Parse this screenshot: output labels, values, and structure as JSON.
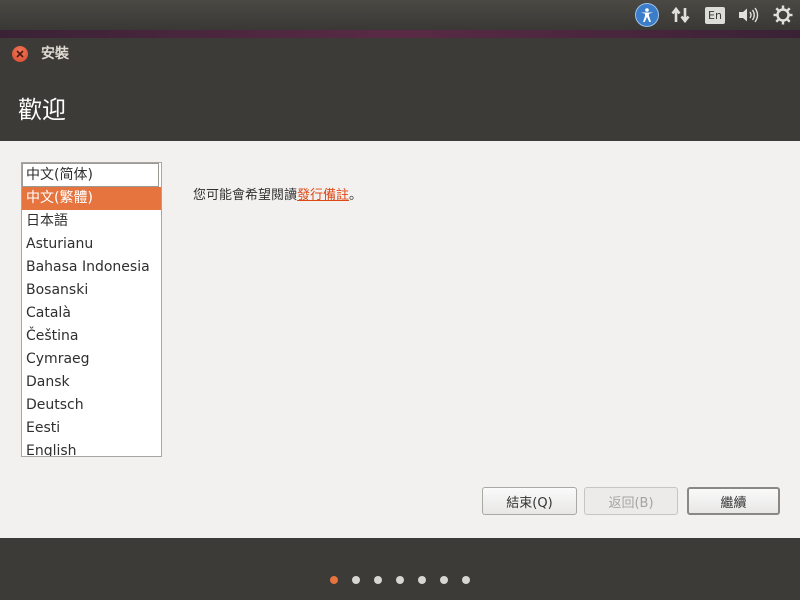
{
  "top_panel": {
    "icons": [
      "accessibility-icon",
      "network-icon",
      "keyboard-language-icon",
      "volume-icon",
      "settings-gear-icon"
    ],
    "keyboard_language": "En"
  },
  "window": {
    "title": "安裝",
    "page_title": "歡迎"
  },
  "languages": {
    "items": [
      "中文(简体)",
      "中文(繁體)",
      "日本語",
      "Asturianu",
      "Bahasa Indonesia",
      "Bosanski",
      "Català",
      "Čeština",
      "Cymraeg",
      "Dansk",
      "Deutsch",
      "Eesti",
      "English"
    ],
    "selected": "中文(繁體)"
  },
  "release_notes": {
    "prefix": "您可能會希望閱讀",
    "link": "發行備註",
    "suffix": "。"
  },
  "buttons": {
    "quit": "結束(Q)",
    "back": "返回(B)",
    "continue": "繼續"
  },
  "progress": {
    "total_steps": 7,
    "current_step": 1
  },
  "colors": {
    "accent": "#e5743e",
    "link": "#dd4814",
    "header_bg": "#3c3b37"
  }
}
